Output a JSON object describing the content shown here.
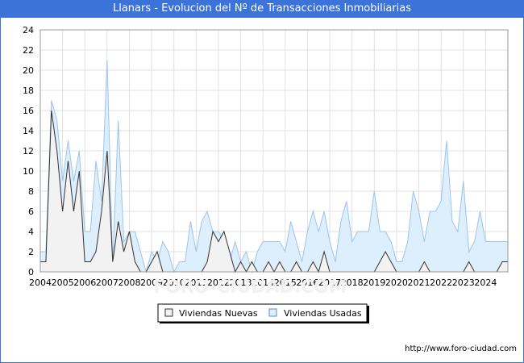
{
  "title": "Llanars - Evolucion del Nº de Transacciones Inmobiliarias",
  "footer": "http://www.foro-ciudad.com",
  "watermark": "FORO-CIUDAD.COM",
  "colors": {
    "nuevas_fill": "#f2f2f2",
    "nuevas_line": "#333333",
    "usadas_fill": "#ddeefc",
    "usadas_line": "#9ec4ec",
    "grid": "#e0e0e0",
    "title_bg": "#3b73d9"
  },
  "chart_data": {
    "type": "area",
    "title": "Llanars - Evolucion del Nº de Transacciones Inmobiliarias",
    "xlabel": "",
    "ylabel": "",
    "x_ticks": [
      "2004",
      "2005",
      "2006",
      "2007",
      "2008",
      "2009",
      "2010",
      "2011",
      "2012",
      "2013",
      "2014",
      "2015",
      "2016",
      "2017",
      "2018",
      "2019",
      "2020",
      "2021",
      "2022",
      "2023",
      "2024"
    ],
    "y_ticks": [
      0,
      2,
      4,
      6,
      8,
      10,
      12,
      14,
      16,
      18,
      20,
      22,
      24
    ],
    "xlim": [
      2004.0,
      2025.0
    ],
    "ylim": [
      0,
      24
    ],
    "grid": true,
    "legend_position": "bottom",
    "legend": [
      "Viviendas Nuevas",
      "Viviendas Usadas"
    ],
    "series": [
      {
        "name": "Viviendas Nuevas",
        "x": [
          2004.0,
          2004.25,
          2004.5,
          2004.75,
          2005.0,
          2005.25,
          2005.5,
          2005.75,
          2006.0,
          2006.25,
          2006.5,
          2006.75,
          2007.0,
          2007.25,
          2007.5,
          2007.75,
          2008.0,
          2008.25,
          2008.5,
          2008.75,
          2009.0,
          2009.25,
          2009.5,
          2009.75,
          2010.0,
          2010.25,
          2010.5,
          2010.75,
          2011.0,
          2011.25,
          2011.5,
          2011.75,
          2012.0,
          2012.25,
          2012.5,
          2012.75,
          2013.0,
          2013.25,
          2013.5,
          2013.75,
          2014.0,
          2014.25,
          2014.5,
          2014.75,
          2015.0,
          2015.25,
          2015.5,
          2015.75,
          2016.0,
          2016.25,
          2016.5,
          2016.75,
          2017.0,
          2017.25,
          2017.5,
          2017.75,
          2018.0,
          2018.25,
          2018.5,
          2018.75,
          2019.0,
          2019.25,
          2019.5,
          2019.75,
          2020.0,
          2020.25,
          2020.5,
          2020.75,
          2021.0,
          2021.25,
          2021.5,
          2021.75,
          2022.0,
          2022.25,
          2022.5,
          2022.75,
          2023.0,
          2023.25,
          2023.5,
          2023.75,
          2024.0,
          2024.25,
          2024.5,
          2024.75
        ],
        "values": [
          1,
          1,
          16,
          12,
          6,
          11,
          6,
          10,
          1,
          1,
          2,
          6,
          12,
          1,
          5,
          2,
          4,
          1,
          0,
          0,
          1,
          2,
          0,
          0,
          0,
          0,
          0,
          0,
          0,
          0,
          1,
          4,
          3,
          4,
          2,
          0,
          1,
          0,
          1,
          0,
          0,
          1,
          0,
          1,
          0,
          0,
          1,
          0,
          0,
          1,
          0,
          2,
          0,
          0,
          0,
          0,
          0,
          0,
          0,
          0,
          0,
          1,
          2,
          1,
          0,
          0,
          0,
          0,
          0,
          1,
          0,
          0,
          0,
          0,
          0,
          0,
          0,
          1,
          0,
          0,
          0,
          0,
          0,
          1
        ]
      },
      {
        "name": "Viviendas Usadas",
        "x": [
          2004.0,
          2004.25,
          2004.5,
          2004.75,
          2005.0,
          2005.25,
          2005.5,
          2005.75,
          2006.0,
          2006.25,
          2006.5,
          2006.75,
          2007.0,
          2007.25,
          2007.5,
          2007.75,
          2008.0,
          2008.25,
          2008.5,
          2008.75,
          2009.0,
          2009.25,
          2009.5,
          2009.75,
          2010.0,
          2010.25,
          2010.5,
          2010.75,
          2011.0,
          2011.25,
          2011.5,
          2011.75,
          2012.0,
          2012.25,
          2012.5,
          2012.75,
          2013.0,
          2013.25,
          2013.5,
          2013.75,
          2014.0,
          2014.25,
          2014.5,
          2014.75,
          2015.0,
          2015.25,
          2015.5,
          2015.75,
          2016.0,
          2016.25,
          2016.5,
          2016.75,
          2017.0,
          2017.25,
          2017.5,
          2017.75,
          2018.0,
          2018.25,
          2018.5,
          2018.75,
          2019.0,
          2019.25,
          2019.5,
          2019.75,
          2020.0,
          2020.25,
          2020.5,
          2020.75,
          2021.0,
          2021.25,
          2021.5,
          2021.75,
          2022.0,
          2022.25,
          2022.5,
          2022.75,
          2023.0,
          2023.25,
          2023.5,
          2023.75,
          2024.0,
          2024.25,
          2024.5,
          2024.75
        ],
        "values": [
          2,
          2,
          17,
          15,
          9,
          13,
          9,
          12,
          4,
          4,
          11,
          7,
          21,
          1,
          15,
          3,
          4,
          4,
          2,
          0,
          2,
          1,
          3,
          2,
          0,
          1,
          1,
          5,
          2,
          5,
          6,
          4,
          4,
          3,
          1,
          3,
          1,
          2,
          0,
          2,
          3,
          3,
          3,
          3,
          2,
          5,
          3,
          1,
          4,
          6,
          4,
          6,
          3,
          1,
          5,
          7,
          3,
          4,
          4,
          4,
          8,
          4,
          4,
          3,
          1,
          1,
          3,
          8,
          6,
          3,
          6,
          6,
          7,
          13,
          5,
          4,
          9,
          2,
          3,
          6,
          3,
          3,
          3,
          3
        ]
      }
    ]
  }
}
